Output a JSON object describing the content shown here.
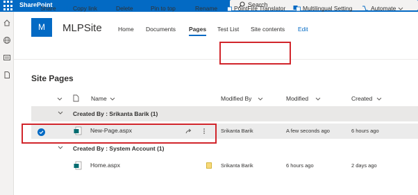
{
  "suitebar": {
    "app_name": "SharePoint",
    "search_placeholder": "Search"
  },
  "site": {
    "logo_letter": "M",
    "title": "MLPSite",
    "nav": [
      "Home",
      "Documents",
      "Pages",
      "Test List",
      "Site contents",
      "Edit"
    ],
    "active_nav": "Pages"
  },
  "commands": [
    {
      "label": "Share",
      "icon": "share-icon"
    },
    {
      "label": "Copy link",
      "icon": "link-icon"
    },
    {
      "label": "Delete",
      "icon": "trash-icon"
    },
    {
      "label": "Pin to top",
      "icon": "pin-icon"
    },
    {
      "label": "Rename",
      "icon": "rename-icon"
    },
    {
      "label": "PointFire Translator",
      "icon": "translate-icon"
    },
    {
      "label": "Multilingual Setting",
      "icon": "translate-icon"
    },
    {
      "label": "Automate",
      "icon": "flow-icon"
    }
  ],
  "page_heading": "Site Pages",
  "columns": {
    "name": "Name",
    "modified_by": "Modified By",
    "modified": "Modified",
    "created": "Created"
  },
  "groups": [
    {
      "label": "Created By : Srikanta Barik (1)",
      "rows": [
        {
          "name": "New-Page.aspx",
          "modified_by": "Srikanta Barik",
          "modified": "A few seconds ago",
          "created": "6 hours ago",
          "selected": true
        }
      ]
    },
    {
      "label": "Created By : System Account (1)",
      "rows": [
        {
          "name": "Home.aspx",
          "modified_by": "Srikanta Barik",
          "modified": "6 hours ago",
          "created": "2 days ago",
          "selected": false
        }
      ]
    }
  ],
  "colors": {
    "accent": "#036ac4",
    "highlight": "#d1242a"
  }
}
